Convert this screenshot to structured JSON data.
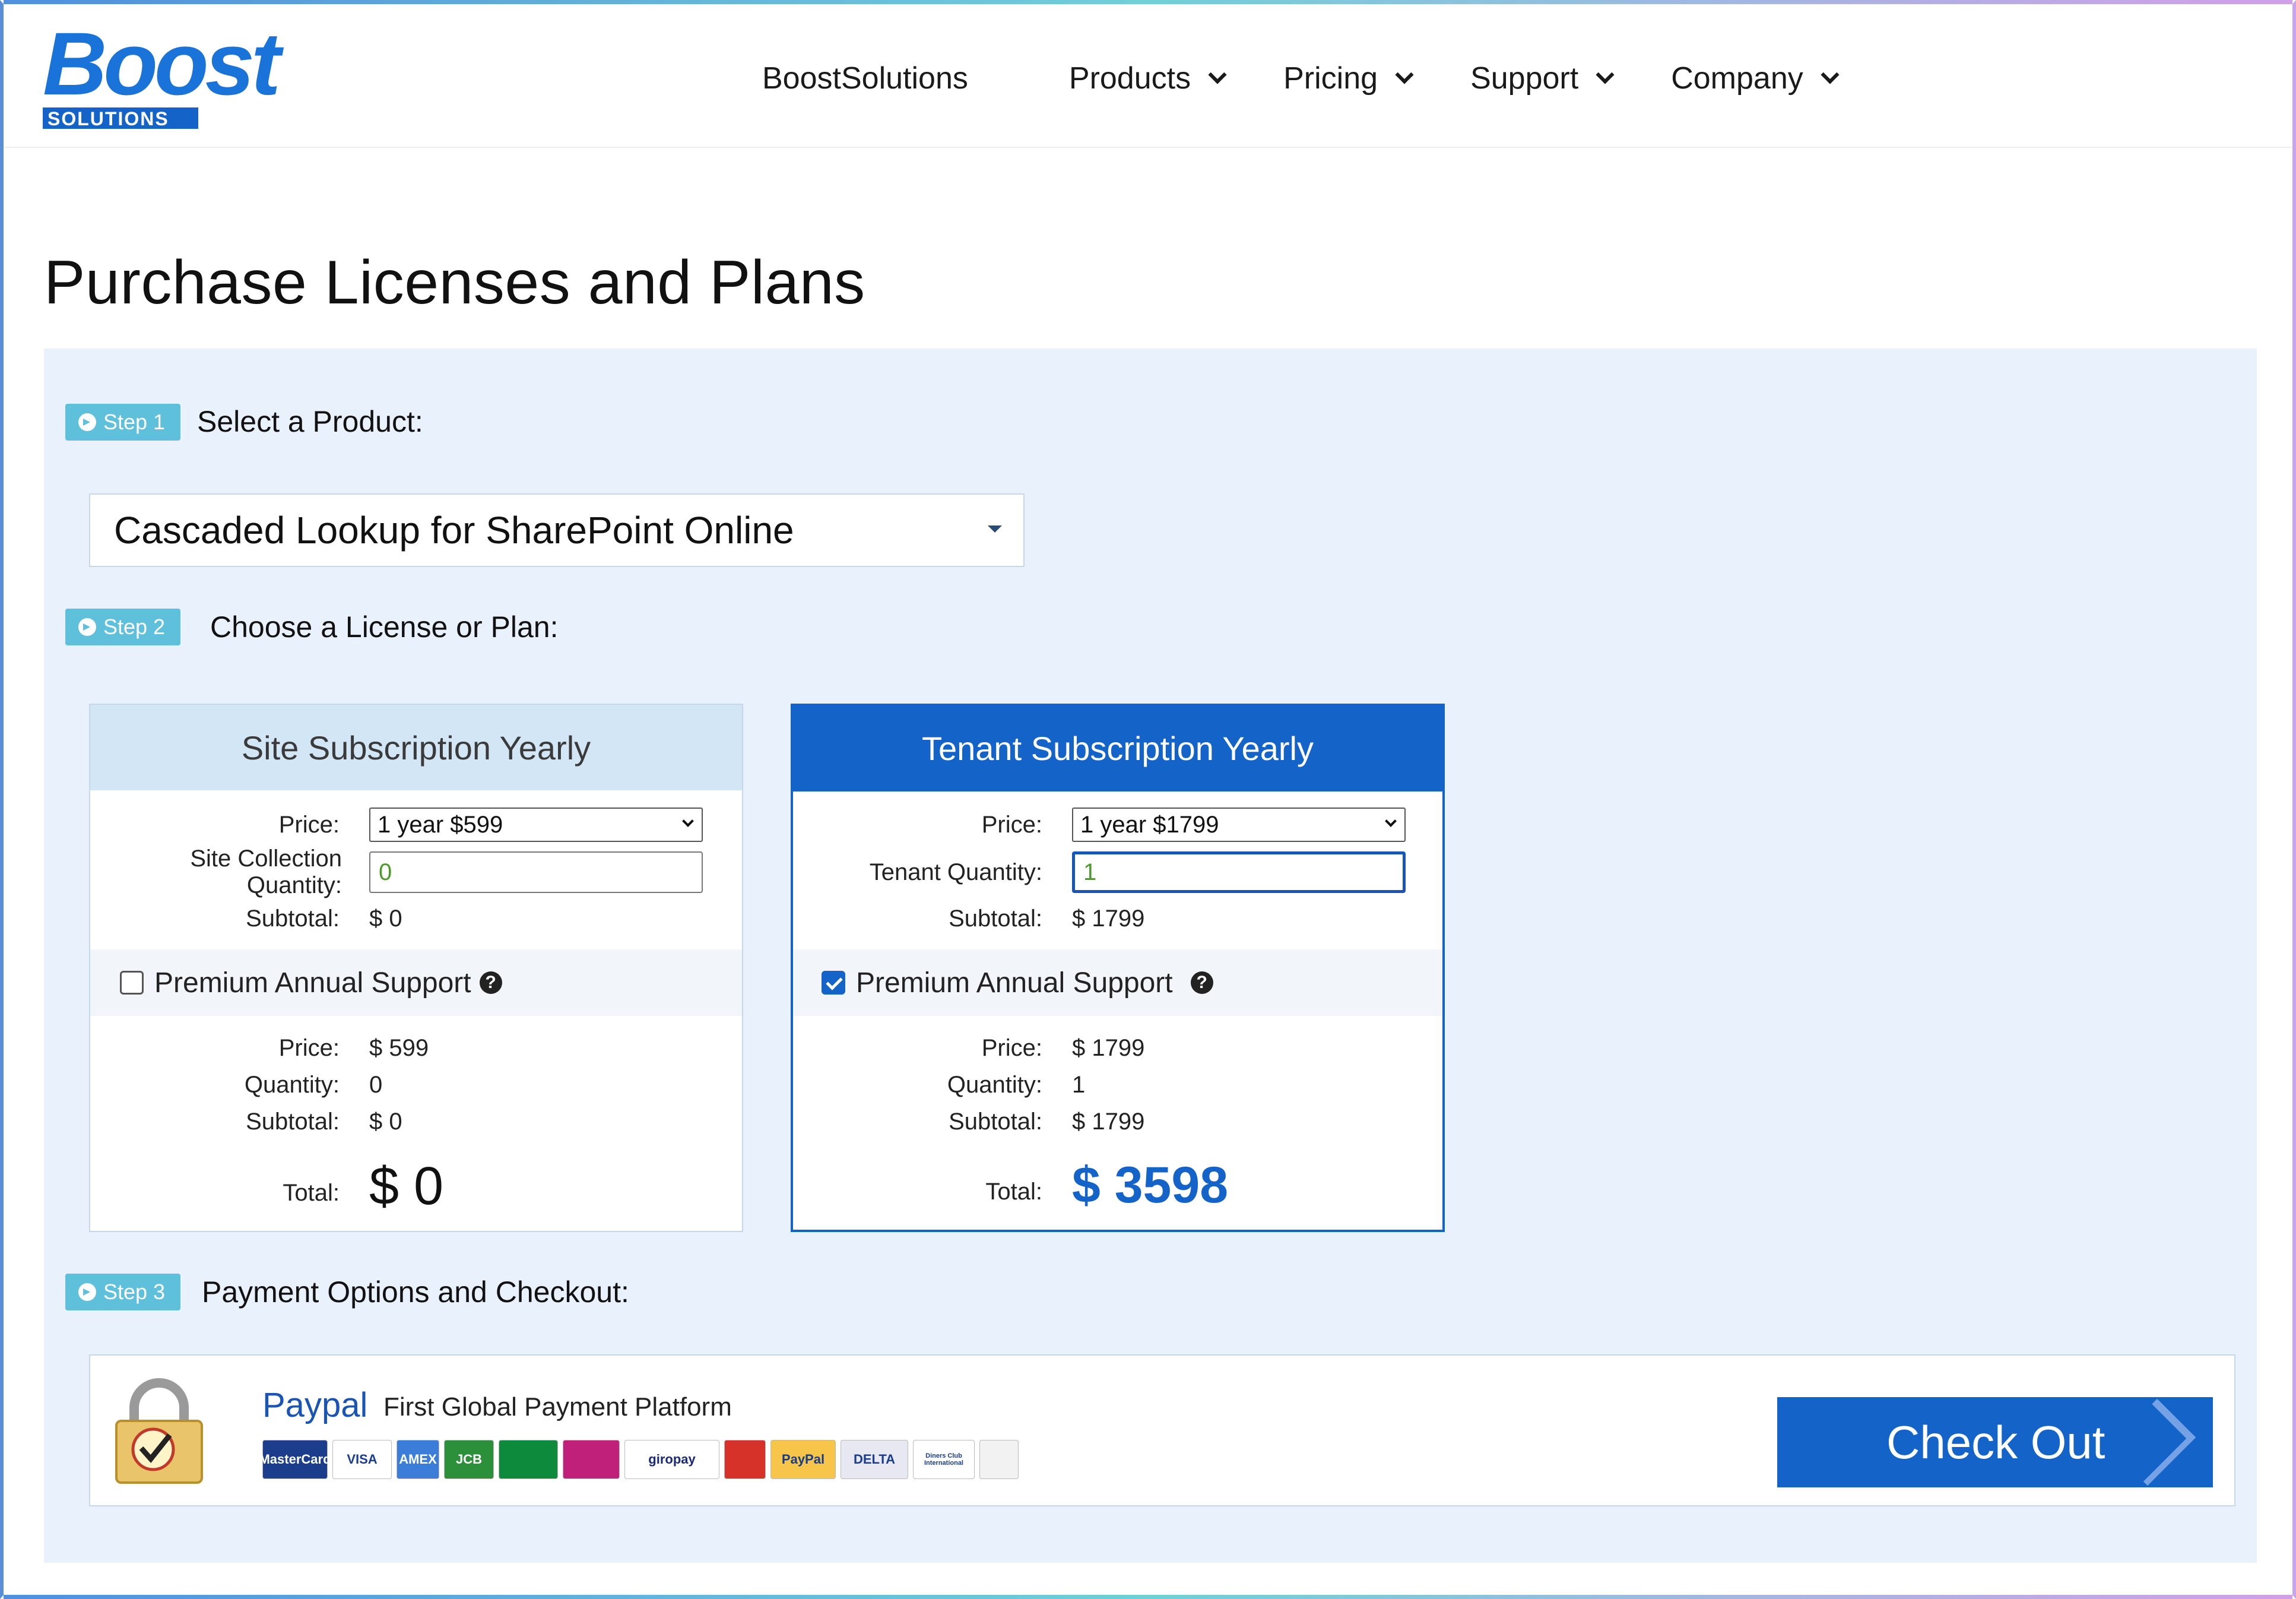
{
  "header": {
    "logo_text": "Boost",
    "logo_sub": "SOLUTIONS",
    "nav": [
      {
        "label": "BoostSolutions",
        "dropdown": false
      },
      {
        "label": "Products",
        "dropdown": true
      },
      {
        "label": "Pricing",
        "dropdown": true
      },
      {
        "label": "Support",
        "dropdown": true
      },
      {
        "label": "Company",
        "dropdown": true
      }
    ]
  },
  "page_title": "Purchase Licenses and Plans",
  "steps": {
    "step1": {
      "badge": "Step 1",
      "label": "Select a Product:"
    },
    "step2": {
      "badge": "Step 2",
      "label": "Choose a License or Plan:"
    },
    "step3": {
      "badge": "Step 3",
      "label": "Payment Options and Checkout:"
    }
  },
  "product_select": {
    "value": "Cascaded Lookup for SharePoint Online"
  },
  "plans": {
    "site": {
      "title": "Site Subscription Yearly",
      "price_label": "Price:",
      "price_value": "1 year $599",
      "qty_label": "Site Collection Quantity:",
      "qty_value": "0",
      "subtotal_label": "Subtotal:",
      "subtotal_value": "$ 0",
      "support_label": "Premium Annual Support",
      "support_checked": false,
      "support_price_label": "Price:",
      "support_price_value": "$ 599",
      "support_qty_label": "Quantity:",
      "support_qty_value": "0",
      "support_subtotal_label": "Subtotal:",
      "support_subtotal_value": "$ 0",
      "total_label": "Total:",
      "total_value": "$ 0"
    },
    "tenant": {
      "title": "Tenant Subscription Yearly",
      "price_label": "Price:",
      "price_value": "1 year $1799",
      "qty_label": "Tenant Quantity:",
      "qty_value": "1",
      "subtotal_label": "Subtotal:",
      "subtotal_value": "$ 1799",
      "support_label": "Premium Annual Support",
      "support_checked": true,
      "support_price_label": "Price:",
      "support_price_value": "$ 1799",
      "support_qty_label": "Quantity:",
      "support_qty_value": "1",
      "support_subtotal_label": "Subtotal:",
      "support_subtotal_value": "$ 1799",
      "total_label": "Total:",
      "total_value": "$ 3598"
    }
  },
  "payment": {
    "provider": "Paypal",
    "tagline": "First Global Payment Platform",
    "lock_icon": "verisign-lock-icon",
    "card_logos": [
      {
        "name": "MasterCard",
        "bg": "#1c3c8c"
      },
      {
        "name": "VISA",
        "bg": "#ffffff",
        "fg": "#1a3d8f"
      },
      {
        "name": "AMEX",
        "bg": "#3b7dd8"
      },
      {
        "name": "JCB",
        "bg": "#2c8f3a"
      },
      {
        "name": "",
        "bg": "#0e8a3c"
      },
      {
        "name": "",
        "bg": "#c0207a"
      },
      {
        "name": "giropay",
        "bg": "#ffffff",
        "fg": "#1a2a7a"
      },
      {
        "name": "",
        "bg": "#d6322a"
      },
      {
        "name": "PayPal",
        "bg": "#f6c549",
        "fg": "#173c87"
      },
      {
        "name": "DELTA",
        "bg": "#e8e8f2",
        "fg": "#1a3d8f"
      },
      {
        "name": "Diners Club International",
        "bg": "#ffffff",
        "fg": "#1a3d8f"
      },
      {
        "name": "",
        "bg": "#f2f2f2",
        "fg": "#1a3d8f"
      }
    ],
    "checkout_label": "Check Out"
  },
  "colors": {
    "accent": "#1463c9",
    "step_badge": "#5fc0dc",
    "panel_bg": "#e9f1fc",
    "qty_text": "#4c9a2a"
  }
}
